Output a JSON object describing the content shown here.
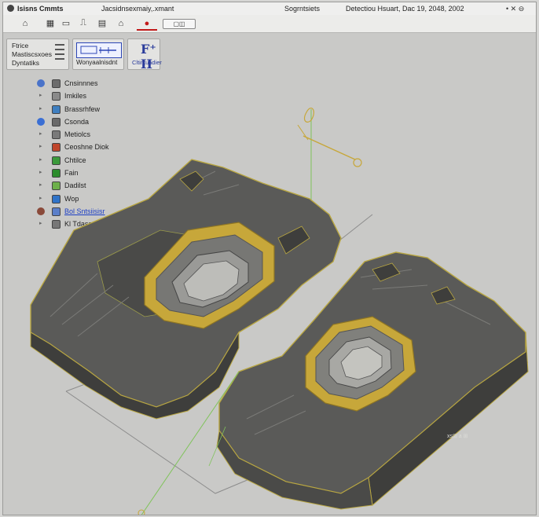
{
  "titlebar": {
    "app_name": "Isisns Cmmts",
    "document": "Jacsidnsexmaiy,.xmant",
    "center": "Sogrntsiets",
    "right": "Detectiou Hsuart, Dac 19, 2048, 2002",
    "controls": "• ✕ ⊖"
  },
  "toolbar": {
    "buttons": [
      {
        "icon": "home-icon",
        "glyph": "⌂"
      },
      {
        "icon": "layers-icon",
        "glyph": "▦"
      },
      {
        "icon": "screen-icon",
        "glyph": "▭"
      },
      {
        "icon": "bookmark-icon",
        "glyph": "⎍"
      },
      {
        "icon": "grid-icon",
        "glyph": "▤"
      },
      {
        "icon": "house-icon",
        "glyph": "⌂"
      },
      {
        "icon": "record-icon",
        "glyph": "●"
      }
    ],
    "field_text": "▢◫"
  },
  "panels": {
    "left_lines": [
      "Ftrice",
      "Mastiscsxoes",
      "Dyntatiks"
    ],
    "thumb_caption": "Wonyaalnisdnt",
    "fx_glyph": "F⁺ II",
    "fx_caption": "Cltirkuadier"
  },
  "tree": {
    "items": [
      {
        "label": "Cnsinnnes",
        "icon_color": "#6c6c6c",
        "expander": "",
        "pre_color": "#4a73c9"
      },
      {
        "label": "Imkiles",
        "icon_color": "#8a8a8a",
        "expander": "▸",
        "pre_color": ""
      },
      {
        "label": "Brassrhfew",
        "icon_color": "#3f7fc0",
        "expander": "▸",
        "pre_color": ""
      },
      {
        "label": "Csonda",
        "icon_color": "#6a6a6a",
        "expander": "",
        "pre_color": "#3b6fd4"
      },
      {
        "label": "Metiolcs",
        "icon_color": "#7a7a7a",
        "expander": "▸",
        "pre_color": ""
      },
      {
        "label": "Ceoshne Diok",
        "icon_color": "#c0462c",
        "expander": "▸",
        "pre_color": ""
      },
      {
        "label": "Chtilce",
        "icon_color": "#3b9a3b",
        "expander": "▸",
        "pre_color": ""
      },
      {
        "label": "Fain",
        "icon_color": "#2b8c2b",
        "expander": "▸",
        "pre_color": ""
      },
      {
        "label": "Dadilst",
        "icon_color": "#6db04a",
        "expander": "▸",
        "pre_color": ""
      },
      {
        "label": "Wop",
        "icon_color": "#2f73c8",
        "expander": "▸",
        "pre_color": ""
      },
      {
        "label": "Bol Sntsiisisr",
        "icon_color": "#5b7fc9",
        "expander": "",
        "pre_color": "#8a4a3a"
      },
      {
        "label": "Kl Tdasa Twlwiotmhog",
        "icon_color": "#777777",
        "expander": "▸",
        "pre_color": ""
      }
    ],
    "selected_index": 10
  },
  "viewport": {
    "part_label": "xs⊞ a ⊞",
    "colors": {
      "body": "#5a5a58",
      "body_dark": "#3e3e3c",
      "edge": "#b8a642",
      "frame": "#c7a73a",
      "guide": "#7fc35a",
      "outline": "#8c8c8c"
    }
  }
}
